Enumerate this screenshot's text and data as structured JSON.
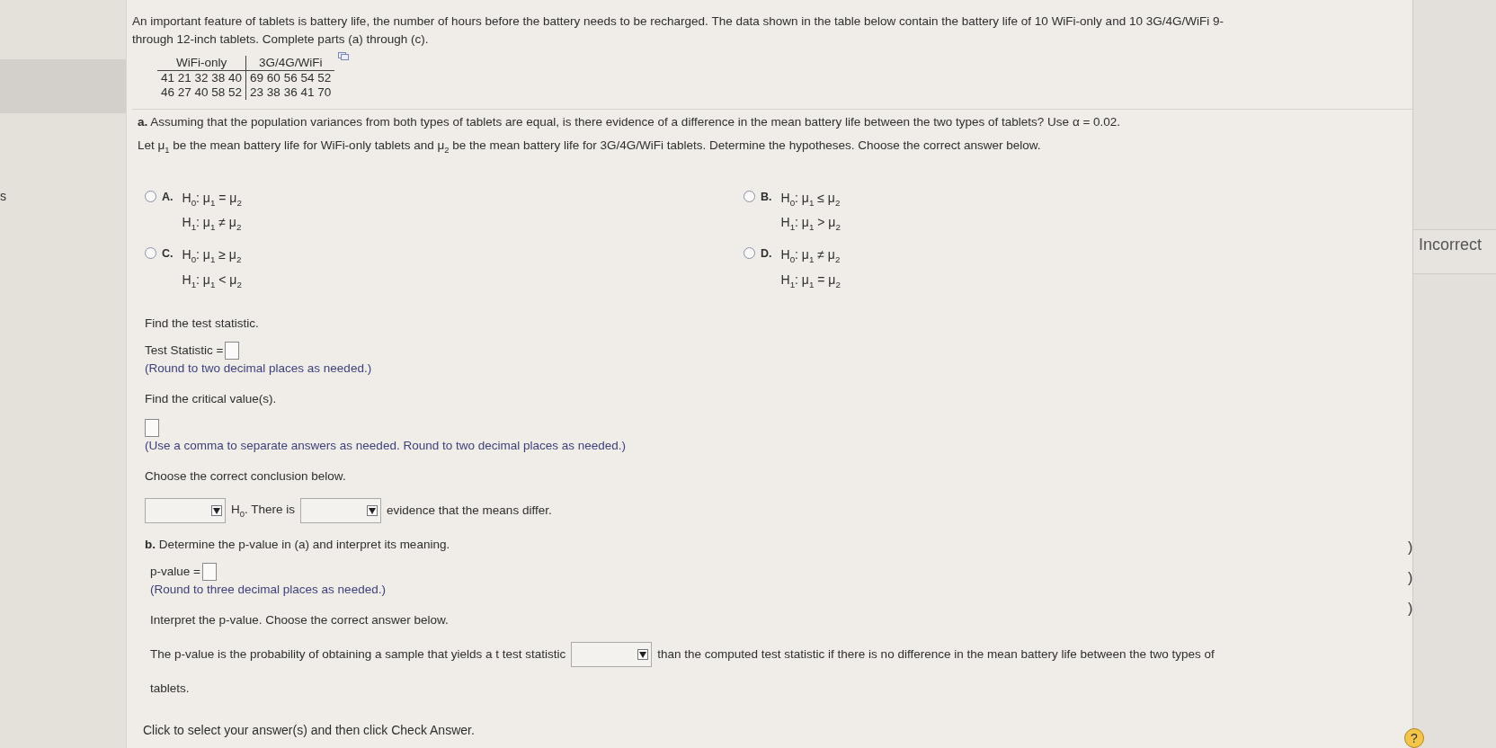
{
  "left_column": {
    "text": "s"
  },
  "intro_lines": [
    "An important feature of tablets is battery life, the number of hours before the battery needs to be recharged. The data shown in the table below contain the battery life of 10 WiFi-only and 10 3G/4G/WiFi 9-",
    "through 12-inch tablets. Complete parts (a) through (c)."
  ],
  "data_table": {
    "columns": [
      "WiFi-only",
      "3G/4G/WiFi"
    ],
    "rows": [
      [
        "41 21 32 38 40",
        "69 60 56 54 52"
      ],
      [
        "46 27 40 58 52",
        "23 38 36 41 70"
      ]
    ]
  },
  "part_a": {
    "question": "**a.** Assuming that the population variances from both types of tablets are equal, is there evidence of a difference in the mean battery life between the two types of tablets? Use α = 0.02.",
    "instruction": "Let μ$_{1}$ be the mean battery life for WiFi-only tablets and μ$_{2}$ be the mean battery life for 3G/4G/WiFi tablets. Determine the hypotheses. Choose the correct answer below.",
    "options": [
      {
        "letter": "A.",
        "h0": "H$_{0}$: μ$_{1}$ = μ$_{2}$",
        "h1": "H$_{1}$: μ$_{1}$ ≠ μ$_{2}$",
        "selected": false
      },
      {
        "letter": "B.",
        "h0": "H$_{0}$: μ$_{1}$ ≤ μ$_{2}$",
        "h1": "H$_{1}$: μ$_{1}$ > μ$_{2}$",
        "selected": false
      },
      {
        "letter": "C.",
        "h0": "H$_{0}$: μ$_{1}$ ≥ μ$_{2}$",
        "h1": "H$_{1}$: μ$_{1}$ < μ$_{2}$",
        "selected": false
      },
      {
        "letter": "D.",
        "h0": "H$_{0}$: μ$_{1}$ ≠ μ$_{2}$",
        "h1": "H$_{1}$: μ$_{1}$ = μ$_{2}$",
        "selected": false
      }
    ],
    "steps": [
      {
        "kind": "prompt",
        "text": "Find the test statistic."
      },
      {
        "kind": "answer",
        "label": "Test Statistic ="
      },
      {
        "kind": "note",
        "text": "(Round to two decimal places as needed.)"
      },
      {
        "kind": "prompt",
        "text": "Find the critical value(s)."
      },
      {
        "kind": "box"
      },
      {
        "kind": "note",
        "text": "(Use a comma to separate answers as needed. Round to two decimal places as needed.)"
      },
      {
        "kind": "prompt",
        "text": "Choose the correct conclusion below."
      },
      {
        "kind": "sentence",
        "parts": [
          {
            "kind": "dropdown"
          },
          {
            "kind": "text",
            "text": "H$_{0}$. There is"
          },
          {
            "kind": "dropdown"
          },
          {
            "kind": "text",
            "text": "evidence that the means differ."
          }
        ]
      }
    ]
  },
  "part_b": {
    "question": "**b.** Determine the p-value in (a) and interpret its meaning.",
    "steps": [
      {
        "kind": "answer",
        "label": "p-value ="
      },
      {
        "kind": "note",
        "text": "(Round to three decimal places as needed.)"
      },
      {
        "kind": "prompt",
        "text": "Interpret the p-value. Choose the correct answer below."
      },
      {
        "kind": "sentence",
        "parts": [
          {
            "kind": "text",
            "text": "The p-value is the probability of obtaining a sample that yields a t test statistic"
          },
          {
            "kind": "dropdown"
          },
          {
            "kind": "text",
            "text": "than the computed test statistic if there is no difference in the mean battery life between the two types of"
          }
        ]
      },
      {
        "kind": "prompt",
        "text": "tablets."
      }
    ]
  },
  "footer": "Click to select your answer(s) and then click Check Answer.",
  "right_column": {
    "status": "Incorrect",
    "marks": [
      ")",
      ")",
      ")"
    ],
    "help": "?"
  }
}
